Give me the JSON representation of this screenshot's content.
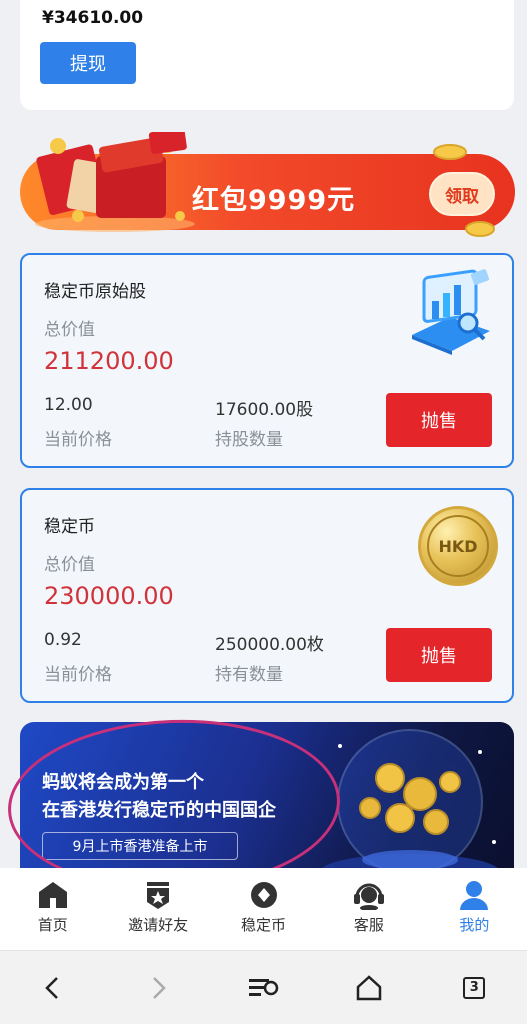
{
  "account": {
    "balance": "¥34610.00",
    "withdraw_label": "提现"
  },
  "redpacket_banner": {
    "title": "红包9999元",
    "button_label": "领取"
  },
  "holdings": [
    {
      "title": "稳定币原始股",
      "total_label": "总价值",
      "total_value": "211200.00",
      "price": "12.00",
      "price_label": "当前价格",
      "quantity": "17600.00股",
      "quantity_label": "持股数量",
      "sell_label": "抛售",
      "icon": "chart-monitor-icon"
    },
    {
      "title": "稳定币",
      "total_label": "总价值",
      "total_value": "230000.00",
      "price": "0.92",
      "price_label": "当前价格",
      "quantity": "250000.00枚",
      "quantity_label": "持有数量",
      "sell_label": "抛售",
      "icon": "hkd-coin-icon",
      "coin_text": "HKD"
    }
  ],
  "promo": {
    "line1": "蚂蚁将会成为第一个",
    "line2": "在香港发行稳定币的中国国企",
    "sub": "9月上市香港准备上市"
  },
  "tabbar": [
    {
      "label": "首页",
      "icon": "home-icon",
      "active": false
    },
    {
      "label": "邀请好友",
      "icon": "invite-badge-icon",
      "active": false
    },
    {
      "label": "稳定币",
      "icon": "coin-diamond-icon",
      "active": false
    },
    {
      "label": "客服",
      "icon": "headset-icon",
      "active": false
    },
    {
      "label": "我的",
      "icon": "user-icon",
      "active": true
    }
  ],
  "browser_nav": {
    "tab_count": "3"
  },
  "colors": {
    "accent_blue": "#2f80e8",
    "sell_red": "#e4262b",
    "value_red": "#d0343a",
    "annotation_pink": "#c8307a"
  }
}
